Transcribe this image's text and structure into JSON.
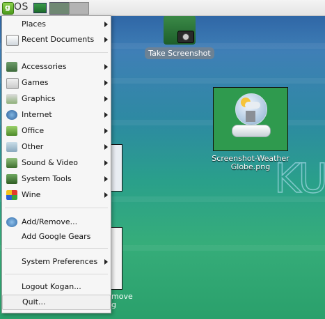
{
  "panel": {
    "os_label": "OS",
    "os_logo_letter": "g"
  },
  "desktop": {
    "screenshot_icon_label": "Take Screenshot",
    "file_icon_label_line1": "Screenshot-Weather",
    "file_icon_label_line2": "Globe.png",
    "partial_caption_line1": "move",
    "partial_caption_line2": "g",
    "background_logo_text": "KU"
  },
  "menu": {
    "items": [
      {
        "label": "Places",
        "icon": "folder-icon",
        "submenu": true
      },
      {
        "label": "Recent Documents",
        "icon": "document-icon",
        "submenu": true
      },
      {
        "label": "Accessories",
        "icon": "accessories-icon",
        "submenu": true
      },
      {
        "label": "Games",
        "icon": "games-icon",
        "submenu": true
      },
      {
        "label": "Graphics",
        "icon": "graphics-icon",
        "submenu": true
      },
      {
        "label": "Internet",
        "icon": "internet-icon",
        "submenu": true
      },
      {
        "label": "Office",
        "icon": "office-icon",
        "submenu": true
      },
      {
        "label": "Other",
        "icon": "other-icon",
        "submenu": true
      },
      {
        "label": "Sound & Video",
        "icon": "sound-video-icon",
        "submenu": true
      },
      {
        "label": "System Tools",
        "icon": "system-tools-icon",
        "submenu": true
      },
      {
        "label": "Wine",
        "icon": "wine-icon",
        "submenu": true
      },
      {
        "label": "Add/Remove...",
        "icon": "add-remove-icon",
        "submenu": false
      },
      {
        "label": "Add Google Gears",
        "icon": "",
        "submenu": false
      },
      {
        "label": "System Preferences",
        "icon": "",
        "submenu": true
      },
      {
        "label": "Logout Kogan...",
        "icon": "",
        "submenu": false
      },
      {
        "label": "Quit...",
        "icon": "",
        "submenu": false
      }
    ]
  },
  "colors": {
    "menu_background": "#f6f6f6",
    "panel_background": "#ececec",
    "desktop_top": "#2f66a6",
    "desktop_bottom": "#2aa06b"
  }
}
